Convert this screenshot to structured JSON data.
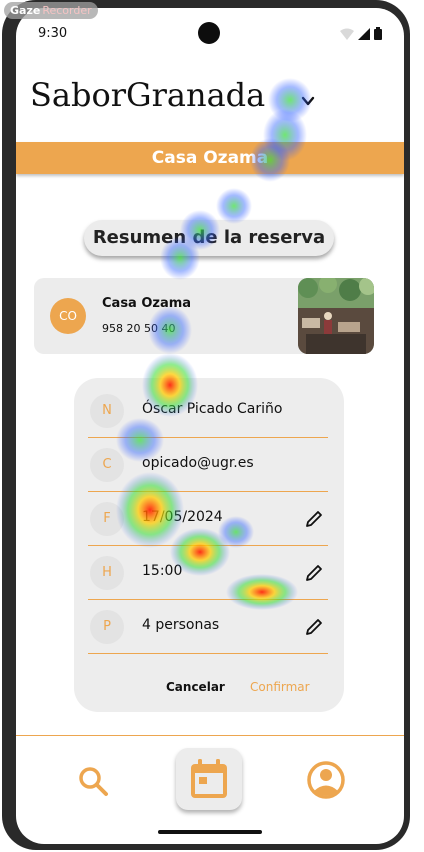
{
  "watermark": {
    "brand": "Gaze",
    "label": "Recorder"
  },
  "status": {
    "time": "9:30"
  },
  "header": {
    "title": "SaborGranada"
  },
  "banner": {
    "restaurant": "Casa Ozama"
  },
  "summary": {
    "title": "Resumen de la reserva"
  },
  "restaurant_card": {
    "initials": "CO",
    "name": "Casa Ozama",
    "phone": "958 20 50 40"
  },
  "form": {
    "rows": [
      {
        "initial": "N",
        "value": "Óscar Picado Cariño",
        "editable": false
      },
      {
        "initial": "C",
        "value": "opicado@ugr.es",
        "editable": false
      },
      {
        "initial": "F",
        "value": "17/05/2024",
        "editable": true
      },
      {
        "initial": "H",
        "value": "15:00",
        "editable": true
      },
      {
        "initial": "P",
        "value": "4 personas",
        "editable": true
      }
    ],
    "cancel_label": "Cancelar",
    "confirm_label": "Confirmar"
  },
  "colors": {
    "accent": "#eda64f",
    "card": "#ececec"
  },
  "icons": {
    "search": "search-icon",
    "calendar": "calendar-icon",
    "profile": "profile-icon",
    "edit": "pencil-icon",
    "dropdown": "chevron-down-icon"
  }
}
